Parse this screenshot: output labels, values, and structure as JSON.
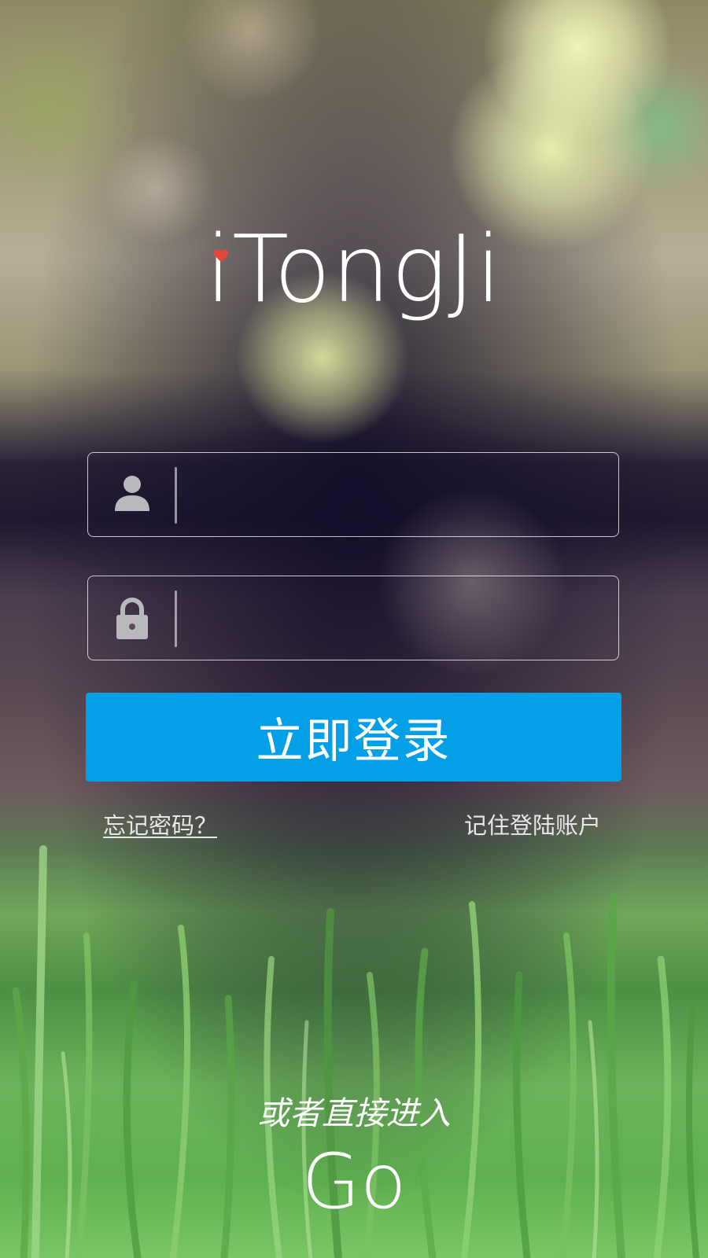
{
  "app": {
    "logo_text": "iTongJi",
    "accent_color": "#03a0e8",
    "heart_color": "#e8463c"
  },
  "form": {
    "username": {
      "icon": "user-icon",
      "value": "",
      "placeholder": ""
    },
    "password": {
      "icon": "lock-icon",
      "value": "",
      "placeholder": ""
    },
    "login_label": "立即登录",
    "forgot_label": "忘记密码？",
    "remember_label": "记住登陆账户"
  },
  "guest": {
    "prompt": "或者直接进入",
    "go_label": "Go"
  }
}
